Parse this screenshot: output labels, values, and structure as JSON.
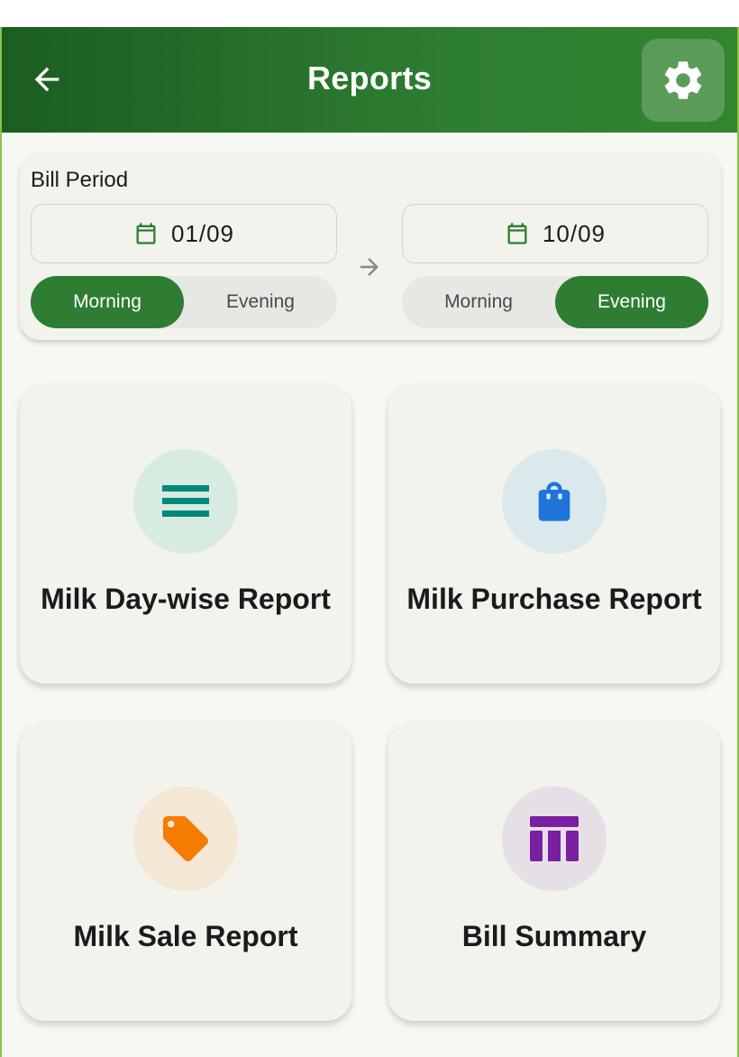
{
  "header": {
    "title": "Reports",
    "back_icon": "arrow-left-icon",
    "settings_icon": "gear-icon"
  },
  "bill_period": {
    "label": "Bill Period",
    "from": {
      "date": "01/09",
      "shift_options": [
        "Morning",
        "Evening"
      ],
      "selected_shift": "Morning"
    },
    "to": {
      "date": "10/09",
      "shift_options": [
        "Morning",
        "Evening"
      ],
      "selected_shift": "Evening"
    }
  },
  "reports": [
    {
      "label": "Milk Day-wise Report",
      "icon": "list-lines-icon",
      "icon_color": "#00897b",
      "circle_color": "#d7ebe1"
    },
    {
      "label": "Milk Purchase Report",
      "icon": "shopping-bag-icon",
      "icon_color": "#1e74d9",
      "circle_color": "#dbe8ec"
    },
    {
      "label": "Milk Sale Report",
      "icon": "price-tag-icon",
      "icon_color": "#f57c00",
      "circle_color": "#f4e7d3"
    },
    {
      "label": "Bill Summary",
      "icon": "table-icon",
      "icon_color": "#7b1fa2",
      "circle_color": "#e6e0e6"
    }
  ],
  "colors": {
    "primary": "#2e7d32",
    "primary_dark": "#1b5e20",
    "background": "#f6f9f1",
    "card": "#f1f3ec"
  }
}
